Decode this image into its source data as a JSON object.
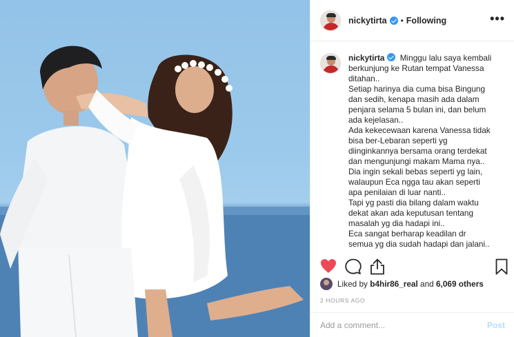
{
  "post": {
    "image_description_alt": "",
    "colors": {
      "accent": "#3897f0",
      "like": "#ed4956",
      "muted": "#999999"
    }
  },
  "header": {
    "username": "nickytirta",
    "separator": "•",
    "follow_status": "Following",
    "more_label": "•••"
  },
  "caption": {
    "username": "nickytirta",
    "lines": [
      "Minggu lalu saya kembali",
      "berkunjung ke Rutan tempat Vanessa",
      "ditahan..",
      "Setiap harinya dia cuma bisa Bingung",
      "dan sedih, kenapa masih ada dalam",
      "penjara selama 5 bulan ini, dan belum",
      "ada kejelasan..",
      "Ada kekecewaan karena Vanessa tidak",
      "bisa ber-Lebaran seperti yg",
      "diinginkannya bersama orang terdekat",
      "dan mengunjungi makam Mama nya..",
      "Dia ingin sekali bebas seperti yg lain,",
      "walaupun Eca ngga tau akan seperti",
      "apa penilaian di luar nanti..",
      "Tapi yg pasti dia bilang dalam waktu",
      "dekat akan ada keputusan tentang",
      "masalah yg dia hadapi ini..",
      "Eca sangat berharap keadilan dr",
      "semua yg dia sudah hadapi dan jalani.."
    ]
  },
  "actions": {
    "like_icon": "heart-icon",
    "comment_icon": "comment-icon",
    "share_icon": "share-icon",
    "save_icon": "bookmark-icon",
    "liked": true
  },
  "likes": {
    "prefix": "Liked by",
    "user": "b4hir86_real",
    "middle": "and",
    "others": "6,069 others"
  },
  "timestamp": "2 HOURS AGO",
  "comment_box": {
    "placeholder": "Add a comment...",
    "post_label": "Post"
  }
}
